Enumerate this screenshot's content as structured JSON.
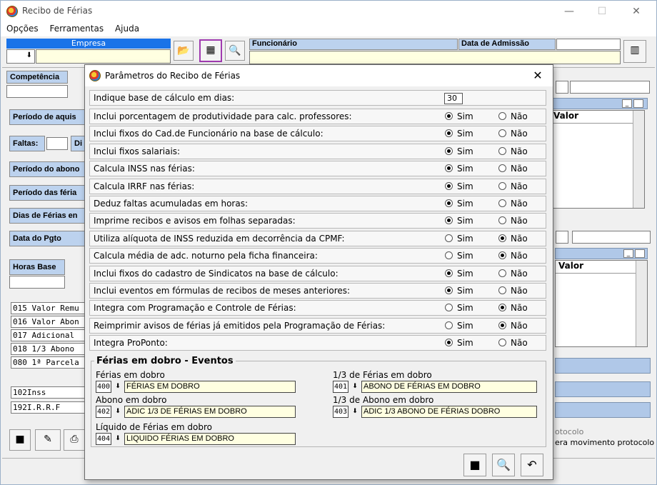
{
  "main": {
    "title": "Recibo de Férias",
    "menu": [
      "Opções",
      "Ferramentas",
      "Ajuda"
    ],
    "empresa_label": "Empresa",
    "funcionario_label": "Funcionário",
    "admissao_label": "Data de Admissão",
    "left_labels": [
      "Competência",
      "Período de aquis",
      "Faltas:",
      "Di",
      "Período do abono",
      "Período das féria",
      "Dias de Férias en",
      "Data do Pgto",
      "Horas Base"
    ],
    "valor_label": "Valor",
    "eventos": [
      {
        "code": "015",
        "name": "Valor Remu"
      },
      {
        "code": "016",
        "name": "Valor Abon"
      },
      {
        "code": "017",
        "name": "Adicional"
      },
      {
        "code": "018",
        "name": "1/3 Abono"
      },
      {
        "code": "080",
        "name": "1ª Parcela"
      }
    ],
    "descontos": [
      {
        "code": "102",
        "name": "Inss"
      },
      {
        "code": "192",
        "name": "I.R.R.F"
      }
    ],
    "protocolo_label": "otocolo",
    "protocolo_text": "era movimento protocolo"
  },
  "modal": {
    "title": "Parâmetros do Recibo de Férias",
    "base_label": "Indique base de cálculo em dias:",
    "base_value": "30",
    "sim": "Sim",
    "nao": "Não",
    "options": [
      {
        "label": "Inclui porcentagem de produtividade para calc. professores:",
        "value": "sim"
      },
      {
        "label": "Inclui fixos do Cad.de Funcionário na base de cálculo:",
        "value": "sim"
      },
      {
        "label": "Inclui fixos salariais:",
        "value": "sim"
      },
      {
        "label": "Calcula INSS nas férias:",
        "value": "sim"
      },
      {
        "label": "Calcula IRRF nas férias:",
        "value": "sim"
      },
      {
        "label": "Deduz faltas acumuladas em horas:",
        "value": "sim"
      },
      {
        "label": "Imprime recibos e avisos em folhas separadas:",
        "value": "sim"
      },
      {
        "label": "Utiliza alíquota de INSS reduzida em decorrência da CPMF:",
        "value": "nao"
      },
      {
        "label": "Calcula média de adc. noturno pela ficha financeira:",
        "value": "nao"
      },
      {
        "label": "Inclui fixos do cadastro de Sindicatos na base de cálculo:",
        "value": "sim"
      },
      {
        "label": "Inclui eventos em fórmulas de recibos de meses anteriores:",
        "value": "sim"
      },
      {
        "label": "Integra com Programação e Controle de Férias:",
        "value": "nao"
      },
      {
        "label": "Reimprimir avisos de férias já emitidos pela Programação de Férias:",
        "value": "nao"
      },
      {
        "label": "Integra ProPonto:",
        "value": "sim"
      }
    ],
    "group": {
      "legend": "Férias em dobro - Eventos",
      "fields": [
        {
          "label": "Férias em dobro",
          "code": "400",
          "name": "FÉRIAS EM DOBRO"
        },
        {
          "label": "1/3 de Férias em dobro",
          "code": "401",
          "name": "ABONO DE FÉRIAS EM DOBRO"
        },
        {
          "label": "Abono em dobro",
          "code": "402",
          "name": "ADIC 1/3 DE FÉRIAS EM DOBRO"
        },
        {
          "label": "1/3 de Abono em dobro",
          "code": "403",
          "name": "ADIC 1/3 ABONO DE FÉRIAS DOBRO"
        },
        {
          "label": "Líquido de Férias em dobro",
          "code": "404",
          "name": "LIQUIDO FÉRIAS EM DOBRO"
        }
      ]
    }
  }
}
